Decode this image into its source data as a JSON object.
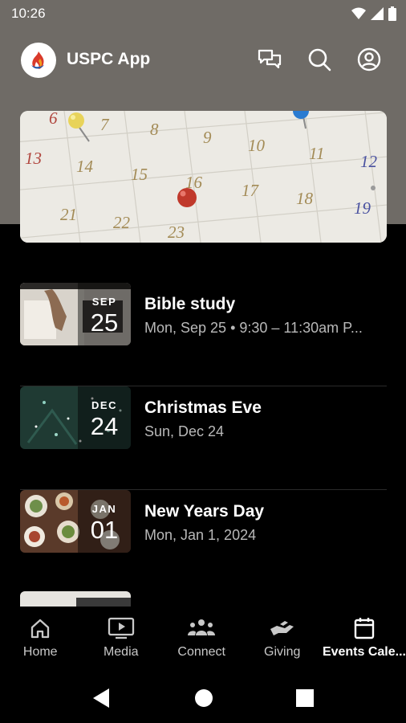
{
  "status_bar": {
    "time": "10:26"
  },
  "app": {
    "title": "USPC App"
  },
  "hero": {
    "calendar_numbers": [
      "6",
      "7",
      "8",
      "9",
      "10",
      "11",
      "12",
      "13",
      "14",
      "15",
      "16",
      "17",
      "18",
      "19",
      "21",
      "22",
      "23"
    ]
  },
  "events": [
    {
      "month": "SEP",
      "day": "25",
      "title": "Bible study",
      "subtitle": "Mon, Sep 25 • 9:30 – 11:30am P..."
    },
    {
      "month": "DEC",
      "day": "24",
      "title": "Christmas Eve",
      "subtitle": "Sun, Dec 24"
    },
    {
      "month": "JAN",
      "day": "01",
      "title": "New Years Day",
      "subtitle": "Mon, Jan 1, 2024"
    }
  ],
  "nav": {
    "items": [
      {
        "label": "Home",
        "icon": "home-icon"
      },
      {
        "label": "Media",
        "icon": "media-icon"
      },
      {
        "label": "Connect",
        "icon": "connect-icon"
      },
      {
        "label": "Giving",
        "icon": "giving-icon"
      },
      {
        "label": "Events Cale...",
        "icon": "calendar-icon"
      }
    ],
    "active_index": 4
  },
  "colors": {
    "header_bg": "#6f6b66",
    "background": "#000000",
    "pin_red": "#c0392b",
    "pin_yellow": "#e8d35a",
    "pin_blue": "#2a7bd1"
  }
}
